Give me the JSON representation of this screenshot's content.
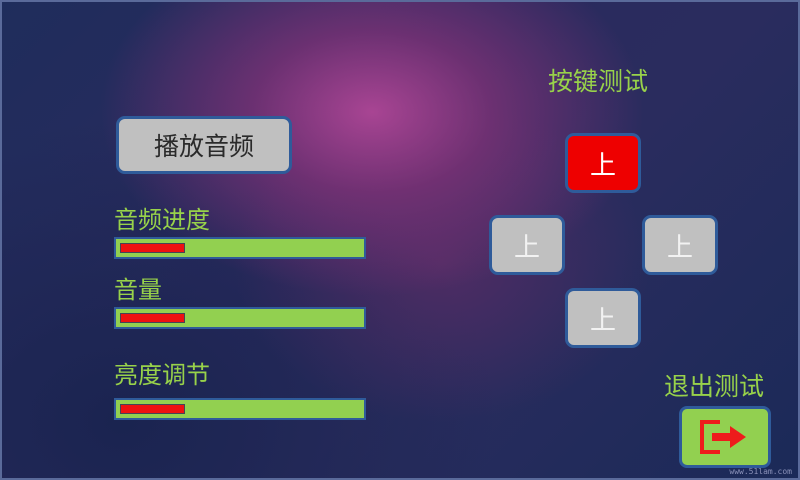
{
  "audio": {
    "play_label": "播放音频",
    "progress_label": "音频进度",
    "progress_level": 0.27,
    "volume_label": "音量",
    "volume_level": 0.27
  },
  "brightness": {
    "label": "亮度调节",
    "level": 0.27
  },
  "key_test": {
    "title": "按键测试",
    "keys": [
      {
        "label": "上",
        "active": true
      },
      {
        "label": "上",
        "active": false
      },
      {
        "label": "上",
        "active": false
      },
      {
        "label": "上",
        "active": false
      }
    ]
  },
  "exit": {
    "label": "退出测试",
    "icon": "exit-icon"
  },
  "watermark": "www.51lam.com",
  "colors": {
    "label_green": "#98d24a",
    "bar_green": "#92d050",
    "bar_red": "#ee1111",
    "key_active": "#ee0000",
    "key_idle": "#c0c0c0",
    "border_blue": "#2f5b9a"
  }
}
